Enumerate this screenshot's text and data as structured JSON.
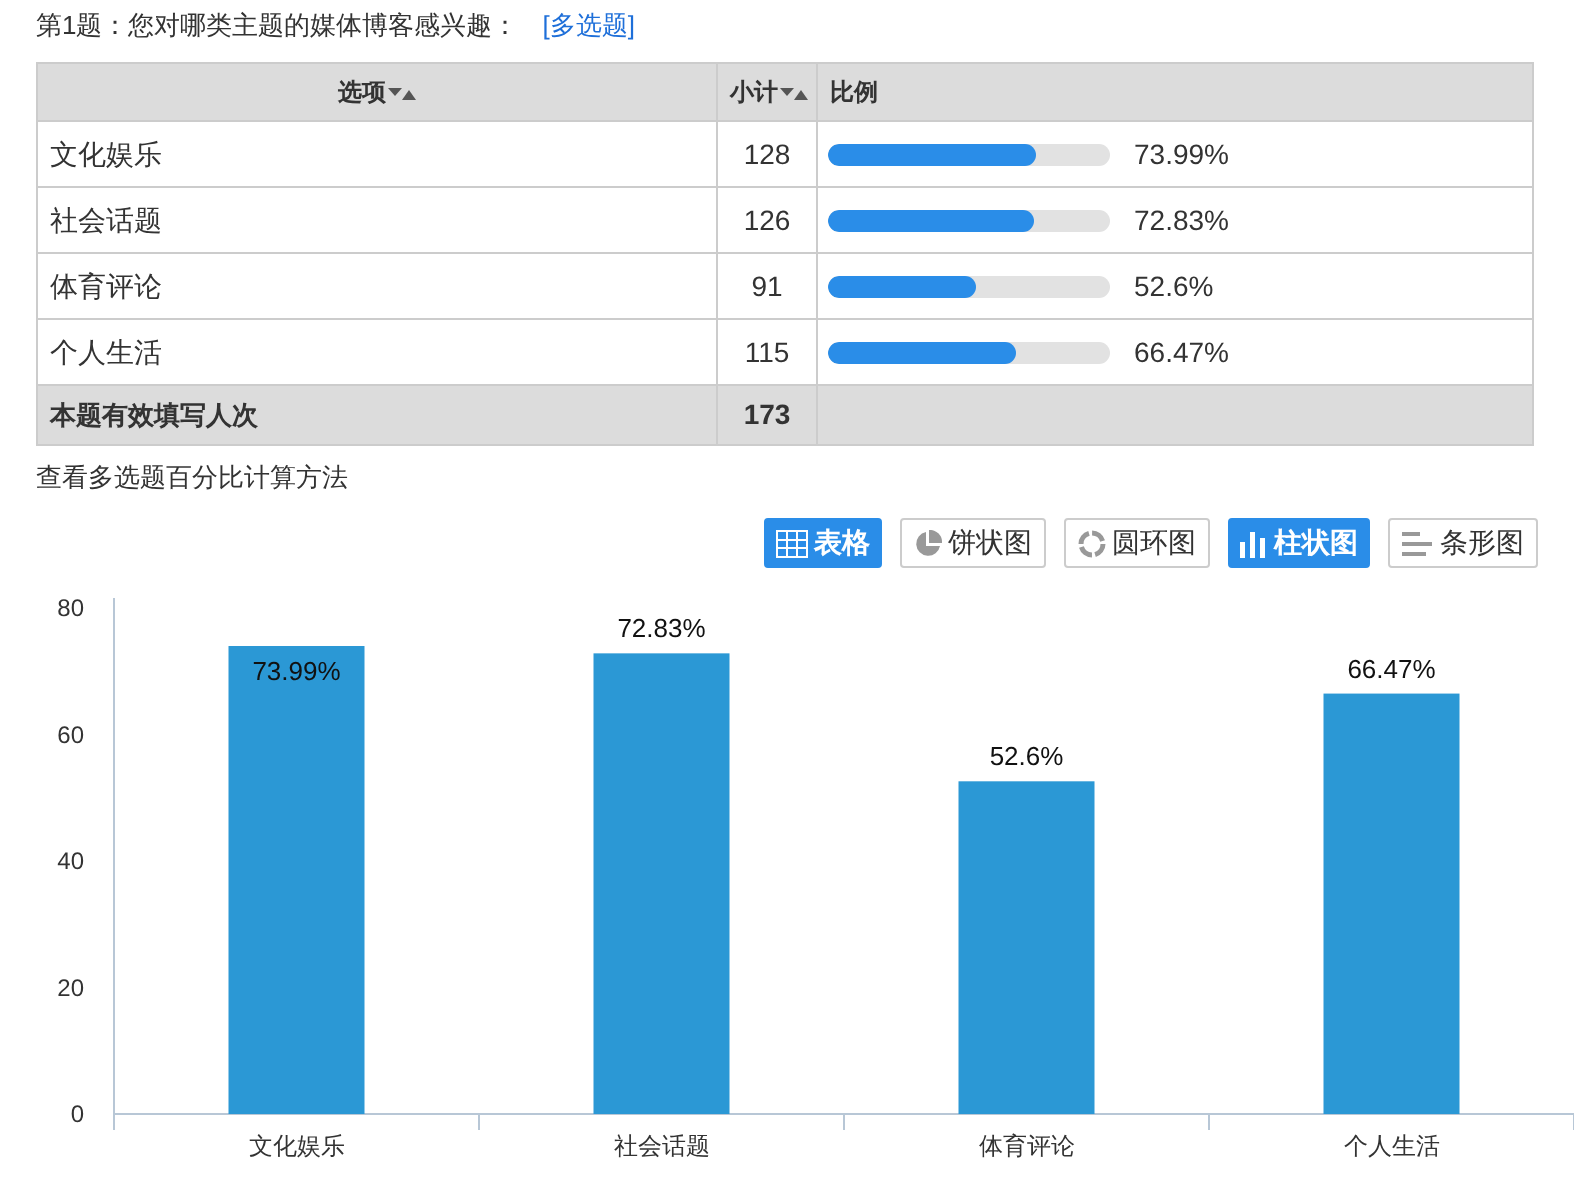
{
  "question": {
    "title": "第1题：您对哪类主题的媒体博客感兴趣：",
    "tag": "[多选题]"
  },
  "table": {
    "columns": [
      "选项",
      "小计",
      "比例"
    ],
    "rows": [
      {
        "option": "文化娱乐",
        "count": "128",
        "level": 0.7399,
        "percent": "73.99%"
      },
      {
        "option": "社会话题",
        "count": "126",
        "level": 0.7283,
        "percent": "72.83%"
      },
      {
        "option": "体育评论",
        "count": "91",
        "level": 0.526,
        "percent": "52.6%"
      },
      {
        "option": "个人生活",
        "count": "115",
        "level": 0.6647,
        "percent": "66.47%"
      }
    ],
    "footer": {
      "label": "本题有效填写人次",
      "count": "173"
    }
  },
  "method_link": "查看多选题百分比计算方法",
  "view_buttons": [
    {
      "label": "表格",
      "selected": true
    },
    {
      "label": "饼状图",
      "selected": false
    },
    {
      "label": "圆环图",
      "selected": false
    },
    {
      "label": "柱状图",
      "selected": true
    },
    {
      "label": "条形图",
      "selected": false
    }
  ],
  "chart": {
    "chart_data": {
      "type": "bar",
      "categories": [
        "文化娱乐",
        "社会话题",
        "体育评论",
        "个人生活"
      ],
      "values": [
        73.99,
        72.83,
        52.6,
        66.47
      ],
      "ylim": [
        0,
        80
      ],
      "yticks": [
        0,
        20,
        40,
        60,
        80
      ],
      "value_labels": [
        "73.99%",
        "72.83%",
        "52.6%",
        "66.47%"
      ]
    }
  }
}
